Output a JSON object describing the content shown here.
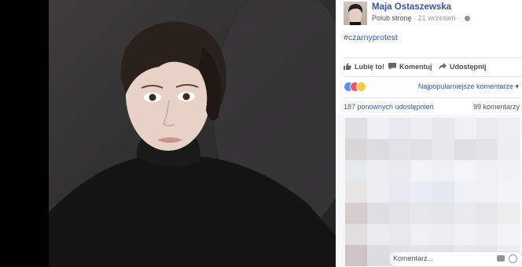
{
  "post": {
    "author": "Maja Ostaszewska",
    "follow_label": "Polub stronę",
    "separator": "·",
    "date": "21 wrzesień",
    "date_separator": "·",
    "hashtag": "#czarnyprotest"
  },
  "actions": {
    "like": "Lubię to!",
    "comment": "Komentuj",
    "share": "Udostępnij"
  },
  "reactions": {
    "icons": [
      "like-icon",
      "love-icon",
      "sad-icon"
    ],
    "sort_label": "Najpopularniejsze komentarze ▾"
  },
  "stats": {
    "shares": "187 ponownych udostępnień",
    "comments": "99 komentarzy"
  },
  "comment_input": {
    "placeholder": "Komentarz..."
  },
  "colors": {
    "link": "#365899",
    "meta": "#90949c",
    "text": "#4b4f56"
  }
}
